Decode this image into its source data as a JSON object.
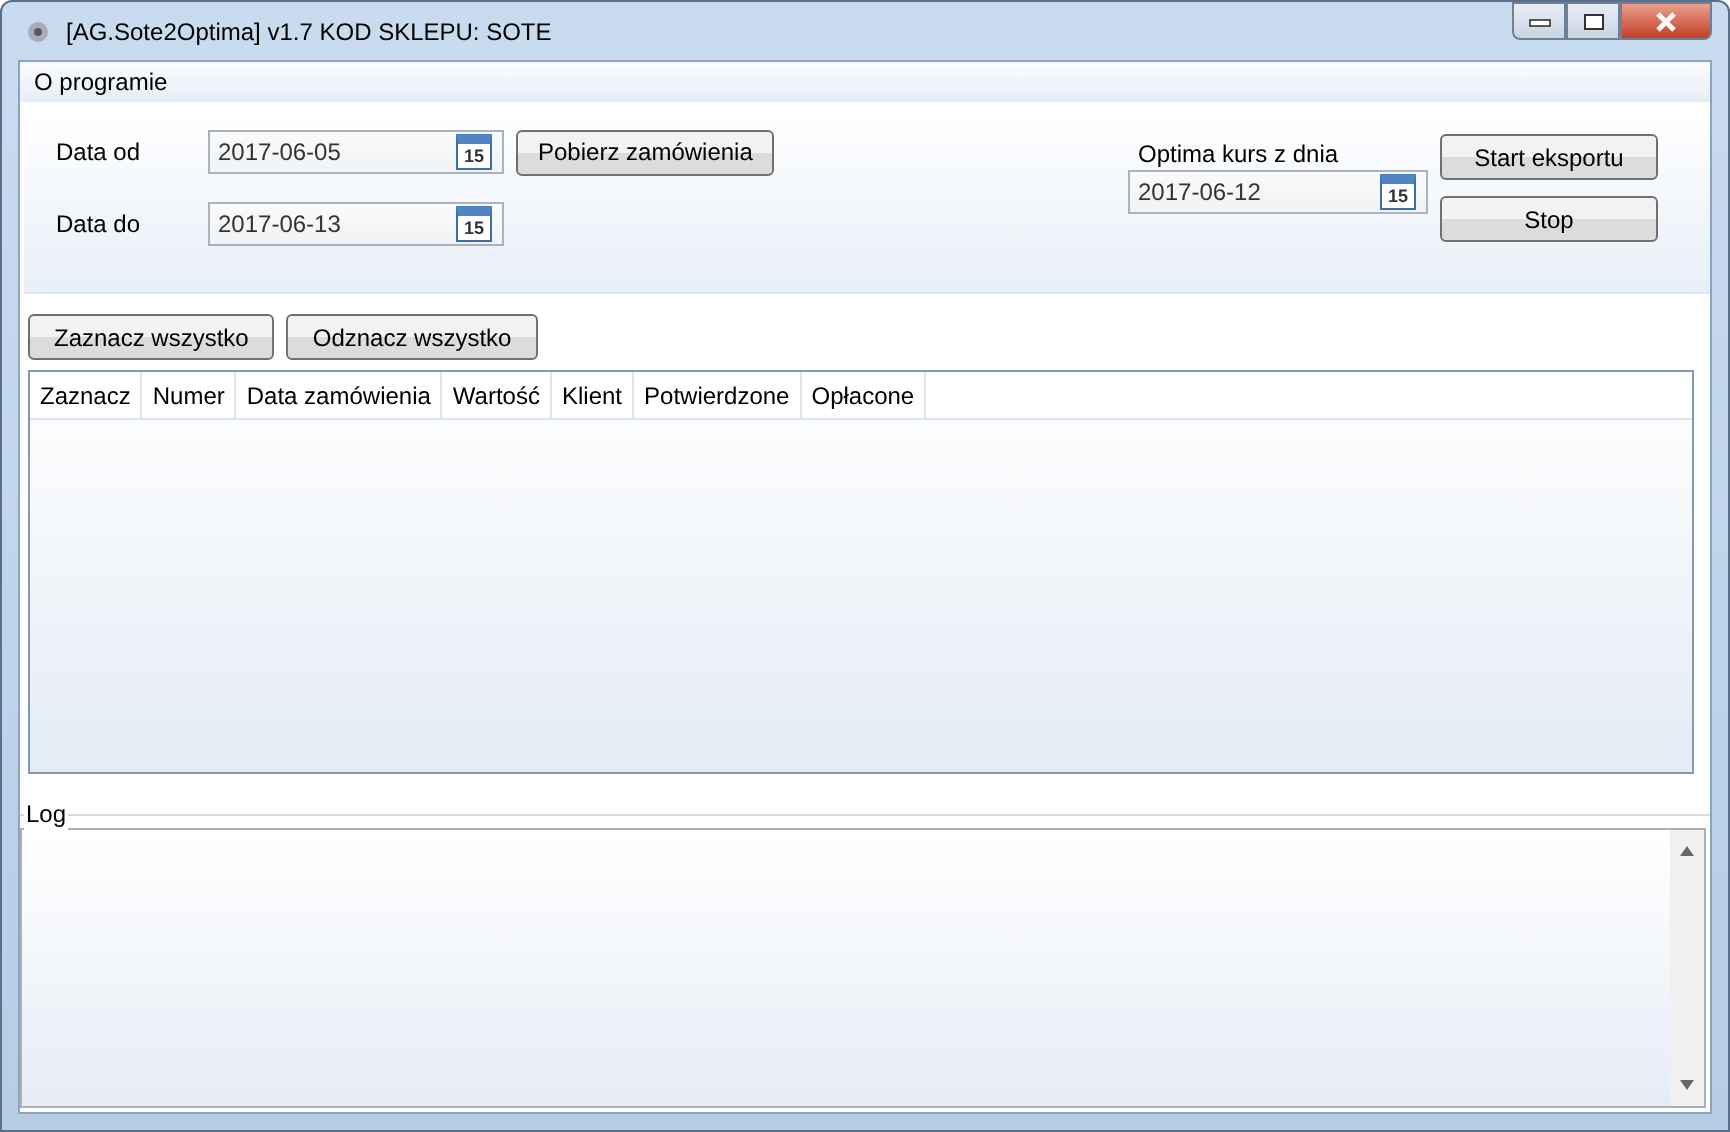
{
  "window": {
    "title": "[AG.Sote2Optima] v1.7 KOD SKLEPU: SOTE"
  },
  "menu": [
    "O programie"
  ],
  "date_from": {
    "label": "Data od",
    "value": "2017-06-05",
    "calendar_day": "15"
  },
  "date_to": {
    "label": "Data do",
    "value": "2017-06-13",
    "calendar_day": "15"
  },
  "fetch_button": "Pobierz zamówienia",
  "rate_date": {
    "label": "Optima kurs z dnia",
    "value": "2017-06-12",
    "calendar_day": "15"
  },
  "export_buttons": [
    "Start eksportu",
    "Stop"
  ],
  "selection_buttons": [
    "Zaznacz wszystko",
    "Odznacz wszystko"
  ],
  "table": {
    "columns": [
      "Zaznacz",
      "Numer",
      "Data zamówienia",
      "Wartość",
      "Klient",
      "Potwierdzone",
      "Opłacone"
    ]
  },
  "log": {
    "label": "Log"
  }
}
